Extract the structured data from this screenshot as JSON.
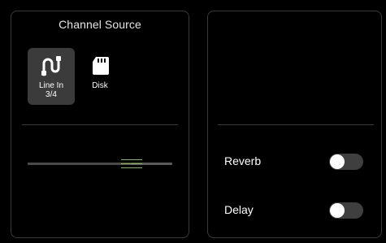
{
  "channel_source": {
    "title": "Channel Source",
    "sources": [
      {
        "label": "Line In\n3/4",
        "icon": "line-in-icon",
        "selected": true
      },
      {
        "label": "Disk",
        "icon": "sd-card-icon",
        "selected": false
      }
    ]
  },
  "fader": {
    "level": 0.72,
    "accent_color": "#7dbb3c"
  },
  "effects": {
    "reverb": {
      "label": "Reverb",
      "enabled": false
    },
    "delay": {
      "label": "Delay",
      "enabled": false
    }
  }
}
